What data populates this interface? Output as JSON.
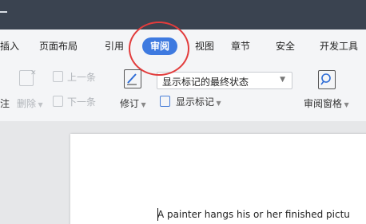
{
  "menu": {
    "tabs": [
      "插入",
      "页面布局",
      "引用",
      "审阅",
      "视图",
      "章节",
      "安全",
      "开发工具"
    ],
    "active_tab": "审阅"
  },
  "ribbon": {
    "comment_partial": "注",
    "delete_label": "删除",
    "prev_label": "上一条",
    "next_label": "下一条",
    "revise_label": "修订",
    "display_select_value": "显示标记的最终状态",
    "show_markup_label": "显示标记",
    "review_pane_label": "审阅窗格"
  },
  "document": {
    "text": "A painter hangs his or her finished pictu"
  },
  "colors": {
    "titlebar": "#3a4350",
    "active_tab": "#3e7ae0",
    "annotation": "#e23c3c"
  }
}
